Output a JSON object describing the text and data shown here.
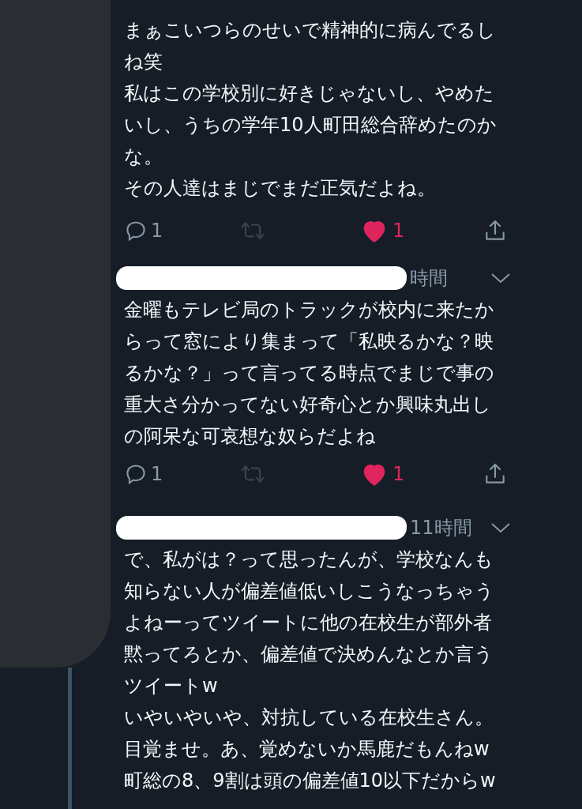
{
  "tweets": [
    {
      "lines": [
        "まぁこいつらのせいで精神的に病んでるし",
        "ね笑",
        "私はこの学校別に好きじゃないし、やめた",
        "いし、うちの学年10人町田総合辞めたのか",
        "な。",
        "その人達はまじでまだ正気だよね。"
      ],
      "reply_count": "1",
      "retweeted": false,
      "liked": true,
      "like_count": "1"
    },
    {
      "time": "時間",
      "lines": [
        "金曜もテレビ局のトラックが校内に来たか",
        "らって窓により集まって「私映るかな？映",
        "るかな？」って言ってる時点でまじで事の",
        "重大さ分かってない好奇心とか興味丸出し",
        "の阿呆な可哀想な奴らだよね"
      ],
      "reply_count": "1",
      "retweeted": false,
      "liked": true,
      "like_count": "1"
    },
    {
      "time": "11時間",
      "lines": [
        "で、私がは？って思ったんが、学校なんも",
        "知らない人が偏差値低いしこうなっちゃう",
        "よねーってツイートに他の在校生が部外者",
        "黙ってろとか、偏差値で決めんなとか言う",
        "ツイートw",
        "いやいやいや、対抗している在校生さん。",
        "目覚ませ。あ、覚めないか馬鹿だもんねw",
        "町総の8、9割は頭の偏差値10以下だからw"
      ]
    }
  ]
}
